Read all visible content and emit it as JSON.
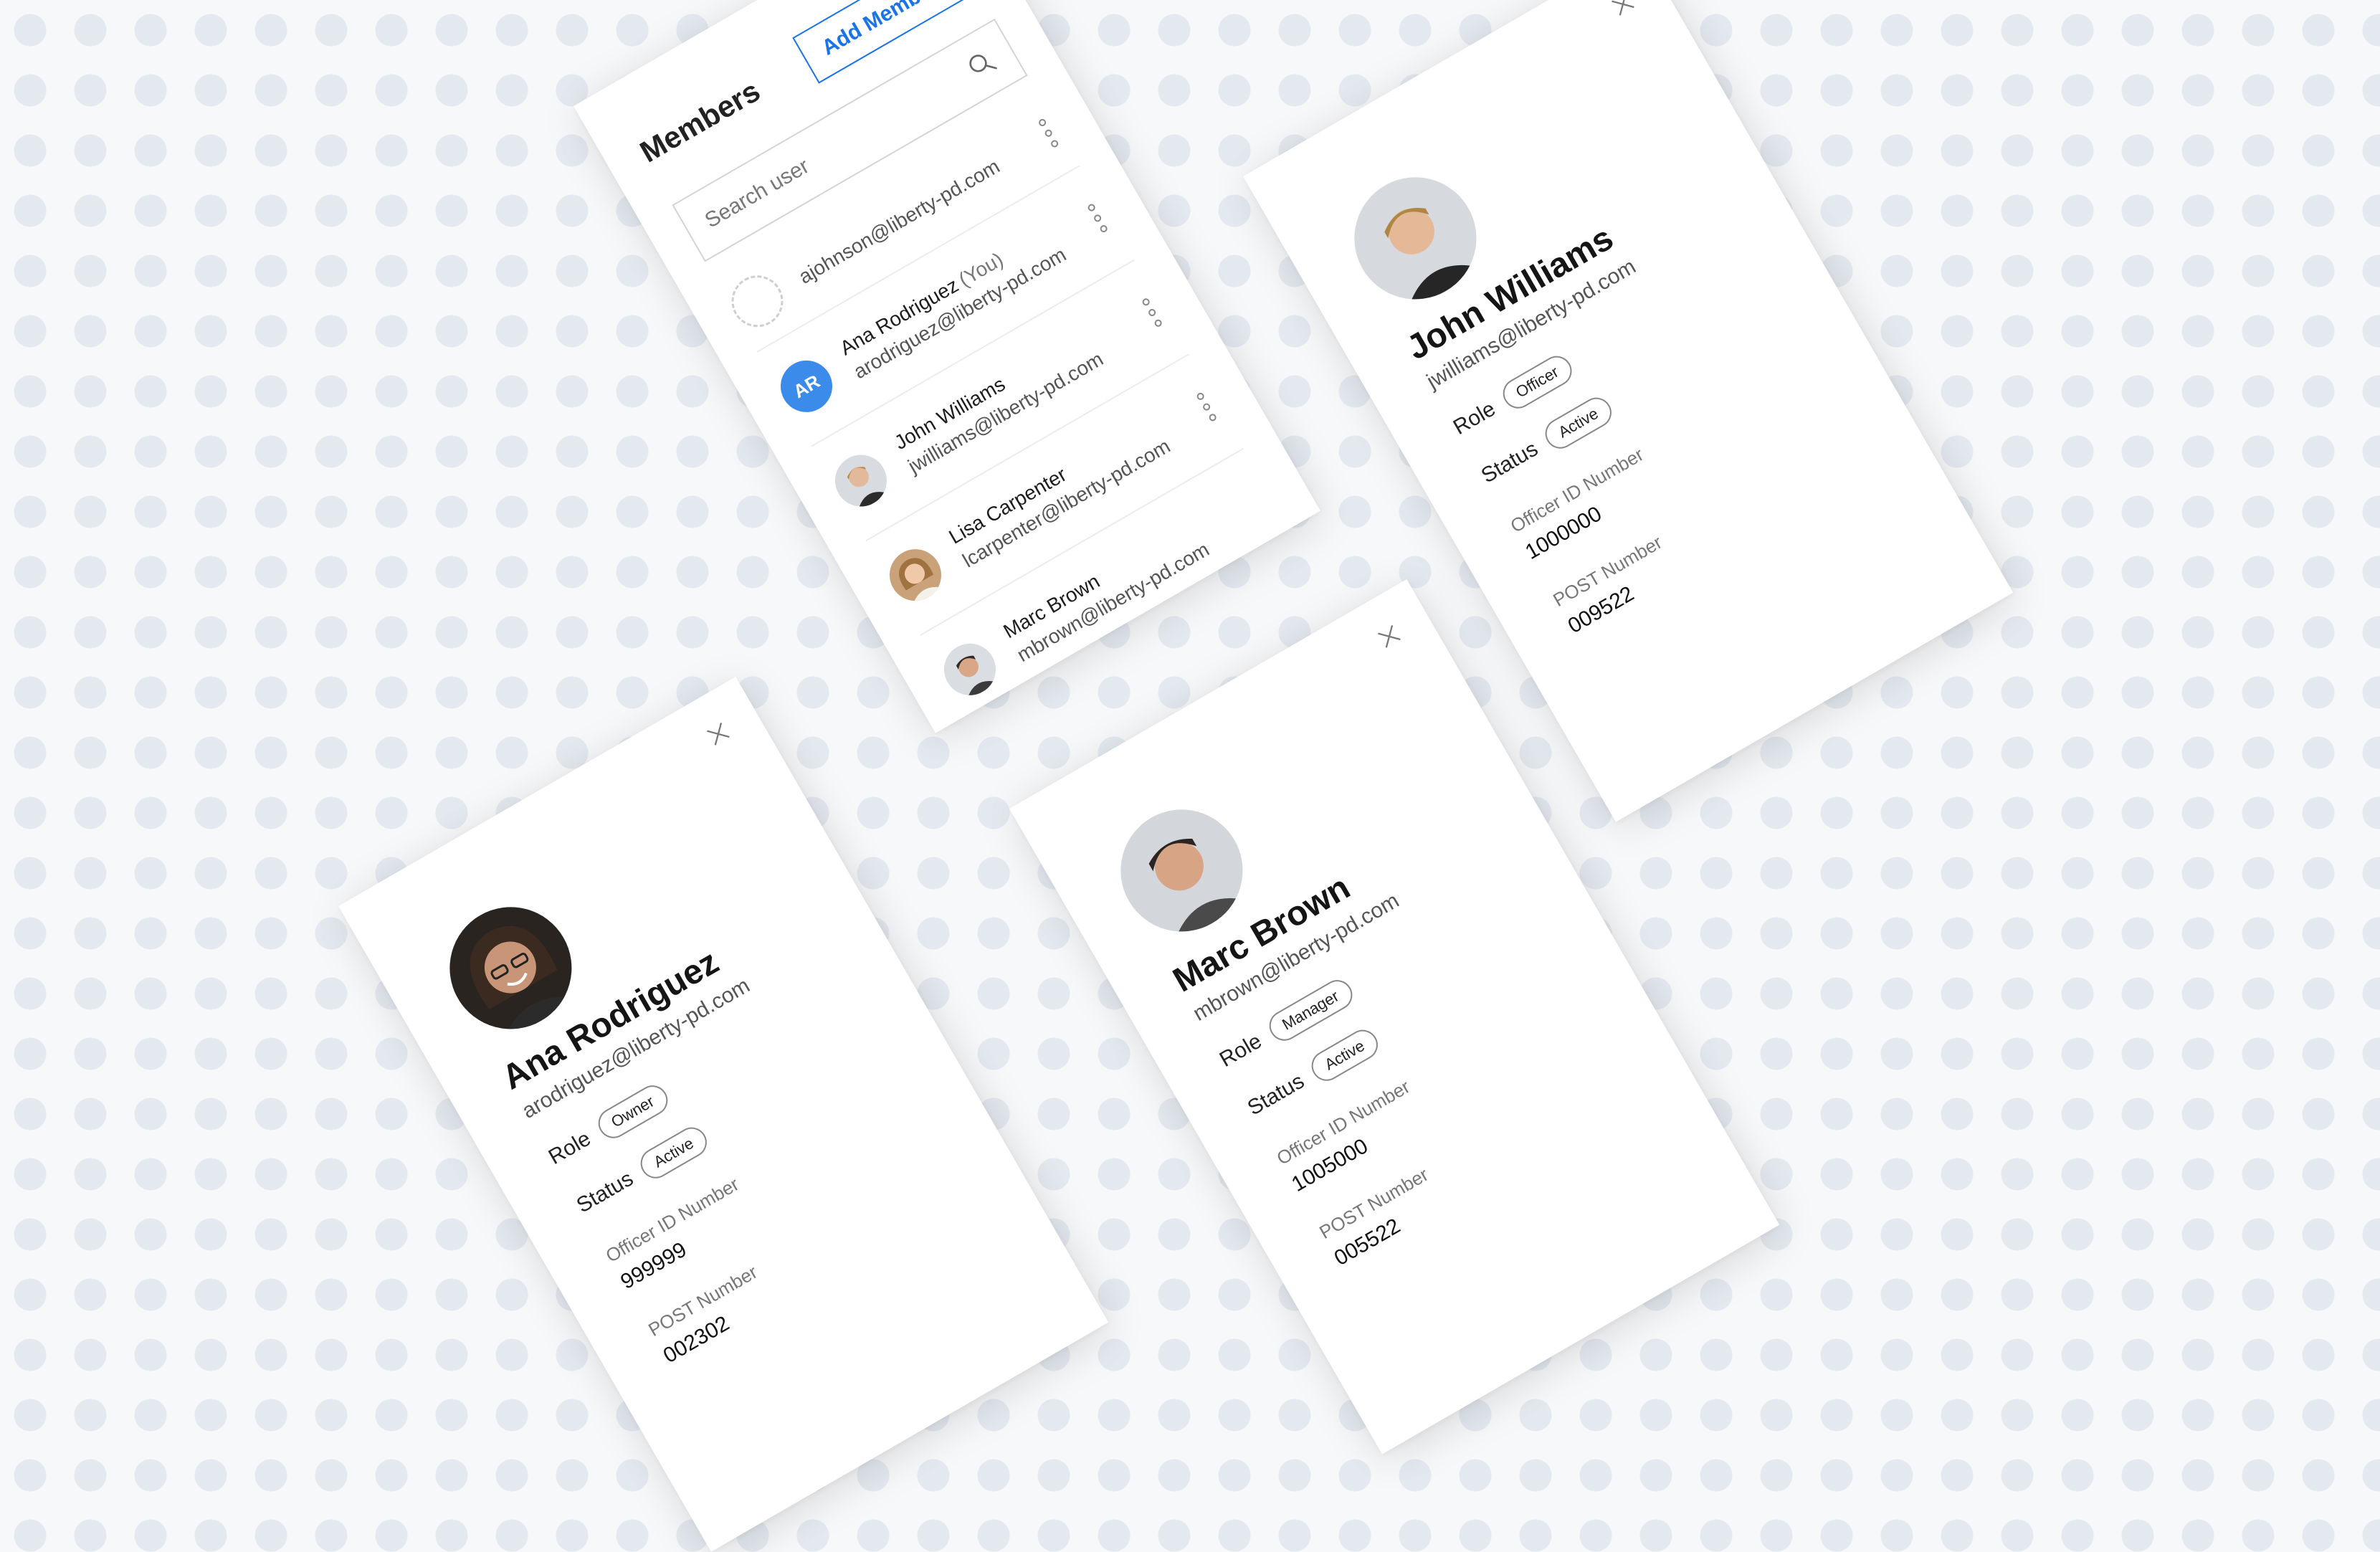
{
  "members_panel": {
    "title": "Members",
    "add_button": "Add Members",
    "search_placeholder": "Search user",
    "members": [
      {
        "name": "",
        "you": "",
        "email": "ajohnson@liberty-pd.com",
        "avatar": "placeholder",
        "initials": ""
      },
      {
        "name": "Ana Rodriguez",
        "you": "(You)",
        "email": "arodriguez@liberty-pd.com",
        "avatar": "initials",
        "initials": "AR"
      },
      {
        "name": "John Williams",
        "you": "",
        "email": "jwilliams@liberty-pd.com",
        "avatar": "photo",
        "initials": ""
      },
      {
        "name": "Lisa Carpenter",
        "you": "",
        "email": "lcarpenter@liberty-pd.com",
        "avatar": "photo",
        "initials": ""
      },
      {
        "name": "Marc Brown",
        "you": "",
        "email": "mbrown@liberty-pd.com",
        "avatar": "photo",
        "initials": ""
      }
    ]
  },
  "profiles": {
    "ana": {
      "name": "Ana Rodriguez",
      "email": "arodriguez@liberty-pd.com",
      "role_label": "Role",
      "role": "Owner",
      "status_label": "Status",
      "status": "Active",
      "officer_id_label": "Officer ID Number",
      "officer_id": "999999",
      "post_label": "POST Number",
      "post": "002302"
    },
    "marc": {
      "name": "Marc Brown",
      "email": "mbrown@liberty-pd.com",
      "role_label": "Role",
      "role": "Manager",
      "status_label": "Status",
      "status": "Active",
      "officer_id_label": "Officer ID Number",
      "officer_id": "1005000",
      "post_label": "POST Number",
      "post": "005522"
    },
    "john": {
      "name": "John Williams",
      "email": "jwilliams@liberty-pd.com",
      "role_label": "Role",
      "role": "Officer",
      "status_label": "Status",
      "status": "Active",
      "officer_id_label": "Officer ID Number",
      "officer_id": "1000000",
      "post_label": "POST Number",
      "post": "009522"
    }
  },
  "colors": {
    "accent": "#1a73e8",
    "initials_avatar": "#3b8beb",
    "background": "#f7f8fa"
  },
  "icons": [
    "search-icon",
    "more-vertical-icon",
    "close-icon"
  ]
}
